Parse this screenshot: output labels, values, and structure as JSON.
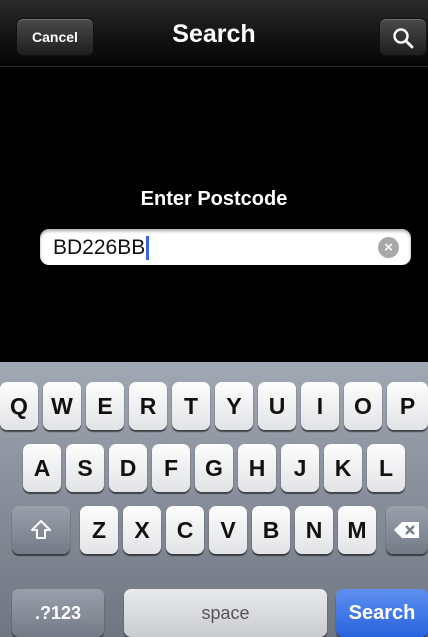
{
  "nav": {
    "cancel_label": "Cancel",
    "title": "Search",
    "search_icon": "magnifier-icon"
  },
  "form": {
    "prompt": "Enter Postcode",
    "postcode_value": "BD226BB",
    "clear_icon": "clear-x-icon"
  },
  "keyboard": {
    "row1": [
      "Q",
      "W",
      "E",
      "R",
      "T",
      "Y",
      "U",
      "I",
      "O",
      "P"
    ],
    "row2": [
      "A",
      "S",
      "D",
      "F",
      "G",
      "H",
      "J",
      "K",
      "L"
    ],
    "row3": [
      "Z",
      "X",
      "C",
      "V",
      "B",
      "N",
      "M"
    ],
    "shift_icon": "shift-arrow-icon",
    "delete_icon": "backspace-icon",
    "mode_label": ".?123",
    "space_label": "space",
    "return_label": "Search"
  },
  "colors": {
    "background": "#000000",
    "caret": "#3a64d8",
    "return_key": "#2763de",
    "keyboard": "#8c929e"
  }
}
